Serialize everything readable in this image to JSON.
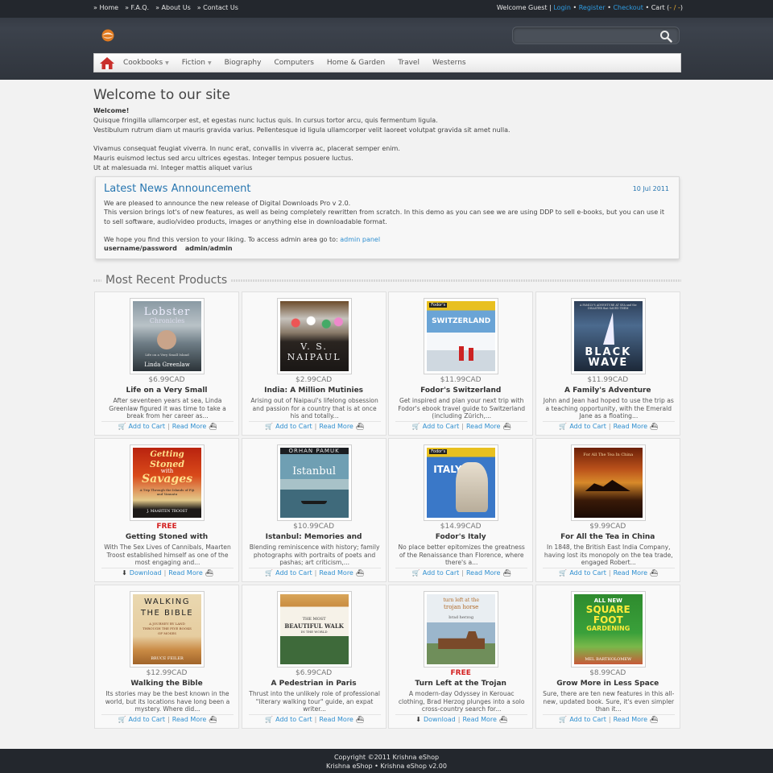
{
  "topbar": {
    "links": [
      "» Home",
      "» F.A.Q.",
      "» About Us",
      "» Contact Us"
    ],
    "welcome": "Welcome Guest |",
    "login": "Login",
    "register": "Register",
    "checkout": "Checkout",
    "cart_label": "Cart (",
    "cart_count": "-",
    "cart_sep": "/",
    "cart_total": "-",
    "cart_close": ")"
  },
  "search": {
    "placeholder": "",
    "icon": "search-icon"
  },
  "nav": {
    "items": [
      {
        "label": "Cookbooks",
        "dropdown": true
      },
      {
        "label": "Fiction",
        "dropdown": true
      },
      {
        "label": "Biography",
        "dropdown": false
      },
      {
        "label": "Computers",
        "dropdown": false
      },
      {
        "label": "Home & Garden",
        "dropdown": false
      },
      {
        "label": "Travel",
        "dropdown": false
      },
      {
        "label": "Westerns",
        "dropdown": false
      }
    ]
  },
  "main": {
    "title": "Welcome to our site",
    "welcome_bold": "Welcome!",
    "lines": [
      "Quisque fringilla ullamcorper est, et egestas nunc luctus quis. In cursus tortor arcu, quis fermentum ligula.",
      "Vestibulum rutrum diam ut mauris gravida varius. Pellentesque id ligula ullamcorper velit laoreet volutpat gravida sit amet nulla.",
      "",
      "Vivamus consequat feugiat viverra. In nunc erat, convallis in viverra ac, placerat semper enim.",
      "Mauris euismod lectus sed arcu ultrices egestas. Integer tempus posuere luctus.",
      "Ut at malesuada mi. Integer mattis aliquet varius"
    ]
  },
  "news": {
    "title": "Latest News Announcement",
    "date": "10 Jul 2011",
    "p1": "We are pleased to announce the new release of Digital Downloads Pro v 2.0.",
    "p2": "This version brings lot's of new features, as well as being completely rewritten from scratch. In this demo as you can see we are using DDP to sell e-books, but you can use it to sell software, audio/video products, images or anything else in downloadable format.",
    "p3_prefix": "We hope you find this version to your liking. To access admin area go to:",
    "admin_link": "admin panel",
    "creds_label": "username/password",
    "creds_value": "admin/admin"
  },
  "recent": {
    "title": "Most Recent Products",
    "add_label": "Add to Cart",
    "download_label": "Download",
    "read_more": "Read More",
    "products": [
      {
        "price": "$6.99CAD",
        "free": false,
        "title": "Life on a Very Small",
        "desc": "After seventeen years at sea, Linda Greenlaw figured it was time to take a break from her career as...",
        "cover": "lobster"
      },
      {
        "price": "$2.99CAD",
        "free": false,
        "title": "India: A Million Mutinies",
        "desc": "Arising out of Naipaul's lifelong obsession and passion for a country that is at once his and totally...",
        "cover": "naipaul"
      },
      {
        "price": "$11.99CAD",
        "free": false,
        "title": "Fodor's Switzerland",
        "desc": "Get inspired and plan your next trip with Fodor's ebook travel guide to Switzerland (including Zürich,...",
        "cover": "switzerland"
      },
      {
        "price": "$11.99CAD",
        "free": false,
        "title": "A Family's Adventure",
        "desc": "John and Jean had hoped to use the trip as a teaching opportunity, with the Emerald Jane as a floating...",
        "cover": "blackwave"
      },
      {
        "price": "FREE",
        "free": true,
        "title": "Getting Stoned with",
        "desc": "With The Sex Lives of Cannibals, Maarten Troost established himself as one of the most engaging and...",
        "cover": "savages"
      },
      {
        "price": "$10.99CAD",
        "free": false,
        "title": "Istanbul: Memories and",
        "desc": "Blending reminiscence with history; family photographs with portraits of poets and pashas; art criticism,...",
        "cover": "istanbul"
      },
      {
        "price": "$14.99CAD",
        "free": false,
        "title": "Fodor's Italy",
        "desc": "No place better epitomizes the greatness of the Renaissance than Florence, where there's a...",
        "cover": "italy"
      },
      {
        "price": "$9.99CAD",
        "free": false,
        "title": "For All the Tea in China",
        "desc": "In 1848, the British East India Company, having lost its monopoly on the tea trade, engaged Robert...",
        "cover": "tea"
      },
      {
        "price": "$12.99CAD",
        "free": false,
        "title": "Walking the Bible",
        "desc": "Its stories may be the best known in the world, but its locations have long been a mystery. Where did...",
        "cover": "bible"
      },
      {
        "price": "$6.99CAD",
        "free": false,
        "title": "A Pedestrian in Paris",
        "desc": "Thrust into the unlikely role of professional \"literary walking tour\" guide, an expat writer...",
        "cover": "paris"
      },
      {
        "price": "FREE",
        "free": true,
        "title": "Turn Left at the Trojan",
        "desc": "A modern-day Odyssey in Kerouac clothing, Brad Herzog plunges into a solo cross-country search for...",
        "cover": "trojan"
      },
      {
        "price": "$8.99CAD",
        "free": false,
        "title": "Grow More in Less Space",
        "desc": "Sure, there are ten new features in this all-new, updated book. Sure, it's even simpler than it...",
        "cover": "garden"
      }
    ]
  },
  "covers": {
    "lobster": {
      "top": "Lobster",
      "sub": "Chronicles",
      "tag": "Life on a Very Small Island",
      "author": "Linda Greenlaw"
    },
    "naipaul": {
      "line1": "V. S.",
      "line2": "NAIPAUL"
    },
    "switzerland": {
      "badge": "Fodor's",
      "title": "SWITZERLAND"
    },
    "blackwave": {
      "top": "A FAMILY'S ADVENTURE AT SEA and the DISASTER that SAVED THEM",
      "title1": "BLACK",
      "title2": "WAVE"
    },
    "savages": {
      "t1": "Getting",
      "t2": "Stoned",
      "t3": "with",
      "t4": "Savages",
      "sub": "A Trip Through the Islands of Fiji and Vanuatu",
      "author": "J. MAARTEN TROOST"
    },
    "istanbul": {
      "author": "ORHAN PAMUK",
      "title": "Istanbul"
    },
    "italy": {
      "badge": "Fodor's",
      "title": "ITALY"
    },
    "tea": {
      "title": "For All The Tea In China"
    },
    "bible": {
      "t1": "WALKING",
      "t2": "THE BIBLE",
      "sub": "A JOURNEY BY LAND THROUGH THE FIVE BOOKS OF MOSES",
      "author": "BRUCE FEILER"
    },
    "paris": {
      "t1": "THE MOST",
      "t2": "BEAUTIFUL WALK",
      "t3": "IN THE WORLD"
    },
    "trojan": {
      "t1": "turn left at the",
      "t2": "trojan horse",
      "author": "brad herzog"
    },
    "garden": {
      "t1": "ALL NEW",
      "t2": "SQUARE",
      "t3": "FOOT",
      "t4": "GARDENING",
      "author": "MEL BARTHOLOMEW"
    }
  },
  "footer": {
    "line1": "Copyright ©2011 Krishna eShop",
    "line2": "Krishna eShop • Krishna eShop v2.00"
  },
  "colors": {
    "accent": "#2f8fd0",
    "header_dark": "#23272d",
    "free_red": "#d42020",
    "news_blue": "#2776b0"
  }
}
